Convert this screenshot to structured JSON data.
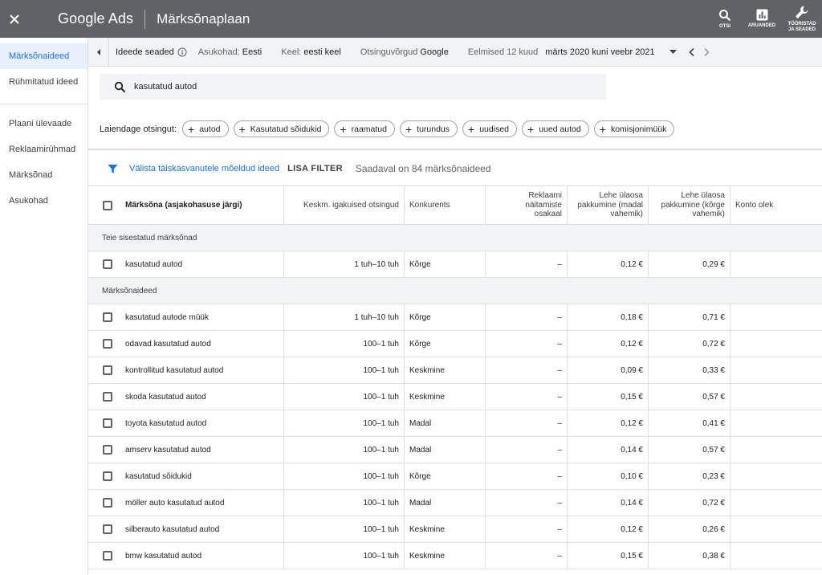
{
  "header": {
    "brand": "Google Ads",
    "title": "Märksõnaplaan",
    "actions": [
      {
        "label": "OTSI",
        "icon": "search-icon"
      },
      {
        "label": "ARUANDED",
        "icon": "reports-icon"
      },
      {
        "label_line1": "TÖÖRISTAD",
        "label_line2": "JA SEADED",
        "icon": "wrench-icon"
      }
    ]
  },
  "sidebar": {
    "items": [
      {
        "label": "Märksõnaideed",
        "active": true
      },
      {
        "label": "Rühmitatud ideed"
      },
      {
        "label": "Plaani ülevaade"
      },
      {
        "label": "Reklaamirühmad"
      },
      {
        "label": "Märksõnad"
      },
      {
        "label": "Asukohad"
      }
    ]
  },
  "settings": {
    "title": "Ideede seaded",
    "location_key": "Asukohad:",
    "location_val": "Eesti",
    "language_key": "Keel:",
    "language_val": "eesti keel",
    "network_key": "Otsinguvõrgud",
    "network_val": "Google",
    "period_key": "Eelmised 12 kuud",
    "period_val": "märts 2020 kuni veebr 2021"
  },
  "search": {
    "value": "kasutatud autod"
  },
  "broaden": {
    "label": "Laiendage otsingut:",
    "chips": [
      "autod",
      "Kasutatud sõidukid",
      "raamatud",
      "turundus",
      "uudised",
      "uued autod",
      "komisjonimüük"
    ]
  },
  "filters": {
    "exclude_label": "Välista täiskasvanutele mõeldud ideed",
    "add_filter": "LISA FILTER",
    "available": "Saadaval on 84 märksõnaideed"
  },
  "table": {
    "headers": {
      "keyword": "Märksõna (asjakohasuse järgi)",
      "avg": "Keskm. igakuised otsingud",
      "competition": "Konkurents",
      "impr_share_1": "Reklaami näitamiste",
      "impr_share_2": "osakaal",
      "low_1": "Lehe ülaosa",
      "low_2": "pakkumine (madal",
      "low_3": "vahemik)",
      "high_1": "Lehe ülaosa",
      "high_2": "pakkumine (kõrge",
      "high_3": "vahemik)",
      "status": "Konto olek"
    },
    "section_entered": "Teie sisestatud märksõnad",
    "entered_rows": [
      {
        "keyword": "kasutatud autod",
        "avg": "1 tuh–10 tuh",
        "competition": "Kõrge",
        "impr": "–",
        "low": "0,12 €",
        "high": "0,29 €"
      }
    ],
    "section_ideas": "Märksõnaideed",
    "idea_rows": [
      {
        "keyword": "kasutatud autode müük",
        "avg": "1 tuh–10 tuh",
        "competition": "Kõrge",
        "impr": "–",
        "low": "0,18 €",
        "high": "0,71 €"
      },
      {
        "keyword": "odavad kasutatud autod",
        "avg": "100–1 tuh",
        "competition": "Kõrge",
        "impr": "–",
        "low": "0,12 €",
        "high": "0,72 €"
      },
      {
        "keyword": "kontrollitud kasutatud autod",
        "avg": "100–1 tuh",
        "competition": "Keskmine",
        "impr": "–",
        "low": "0,09 €",
        "high": "0,33 €"
      },
      {
        "keyword": "skoda kasutatud autod",
        "avg": "100–1 tuh",
        "competition": "Keskmine",
        "impr": "–",
        "low": "0,15 €",
        "high": "0,57 €"
      },
      {
        "keyword": "toyota kasutatud autod",
        "avg": "100–1 tuh",
        "competition": "Madal",
        "impr": "–",
        "low": "0,12 €",
        "high": "0,41 €"
      },
      {
        "keyword": "amserv kasutatud autod",
        "avg": "100–1 tuh",
        "competition": "Madal",
        "impr": "–",
        "low": "0,14 €",
        "high": "0,57 €"
      },
      {
        "keyword": "kasutatud sõidukid",
        "avg": "100–1 tuh",
        "competition": "Kõrge",
        "impr": "–",
        "low": "0,10 €",
        "high": "0,23 €"
      },
      {
        "keyword": "möller auto kasutatud autod",
        "avg": "100–1 tuh",
        "competition": "Madal",
        "impr": "–",
        "low": "0,14 €",
        "high": "0,72 €"
      },
      {
        "keyword": "silberauto kasutatud autod",
        "avg": "100–1 tuh",
        "competition": "Keskmine",
        "impr": "–",
        "low": "0,12 €",
        "high": "0,26 €"
      },
      {
        "keyword": "bmw kasutatud autod",
        "avg": "100–1 tuh",
        "competition": "Keskmine",
        "impr": "–",
        "low": "0,15 €",
        "high": "0,38 €"
      }
    ]
  },
  "colors": {
    "topbar": "#5f6368",
    "accent": "#1a73e8",
    "active_bg": "#e8f0fe"
  }
}
